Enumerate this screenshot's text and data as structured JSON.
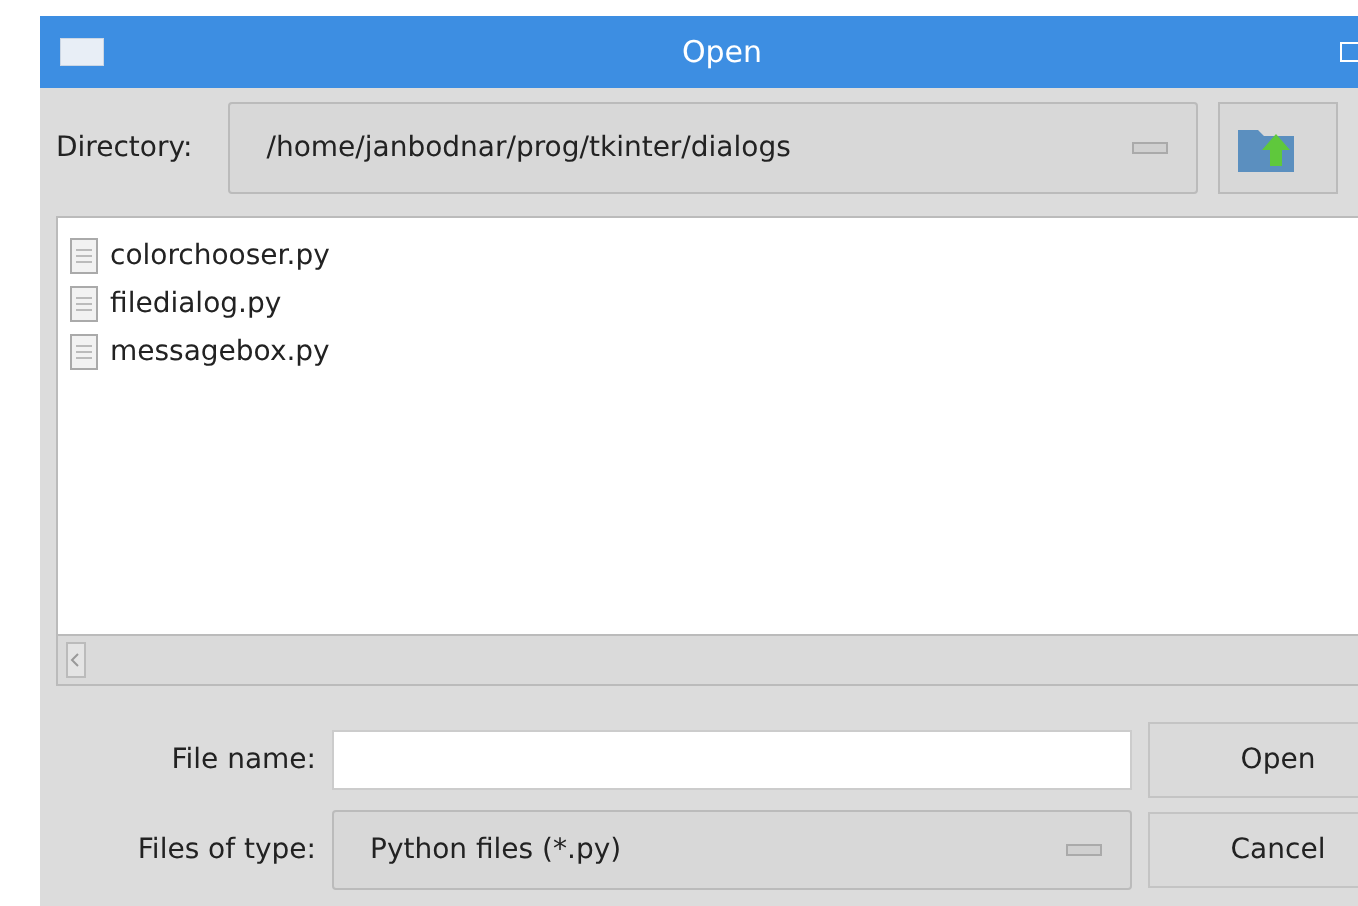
{
  "window": {
    "title": "Open"
  },
  "directory": {
    "label": "Directory:",
    "value": "/home/janbodnar/prog/tkinter/dialogs"
  },
  "files": [
    {
      "name": "colorchooser.py"
    },
    {
      "name": "filedialog.py"
    },
    {
      "name": "messagebox.py"
    }
  ],
  "file_name": {
    "label": "File name:"
  },
  "file_type": {
    "label": "Files of type:",
    "value": "Python files (*.py)"
  },
  "buttons": [
    "Open",
    "Cancel"
  ]
}
